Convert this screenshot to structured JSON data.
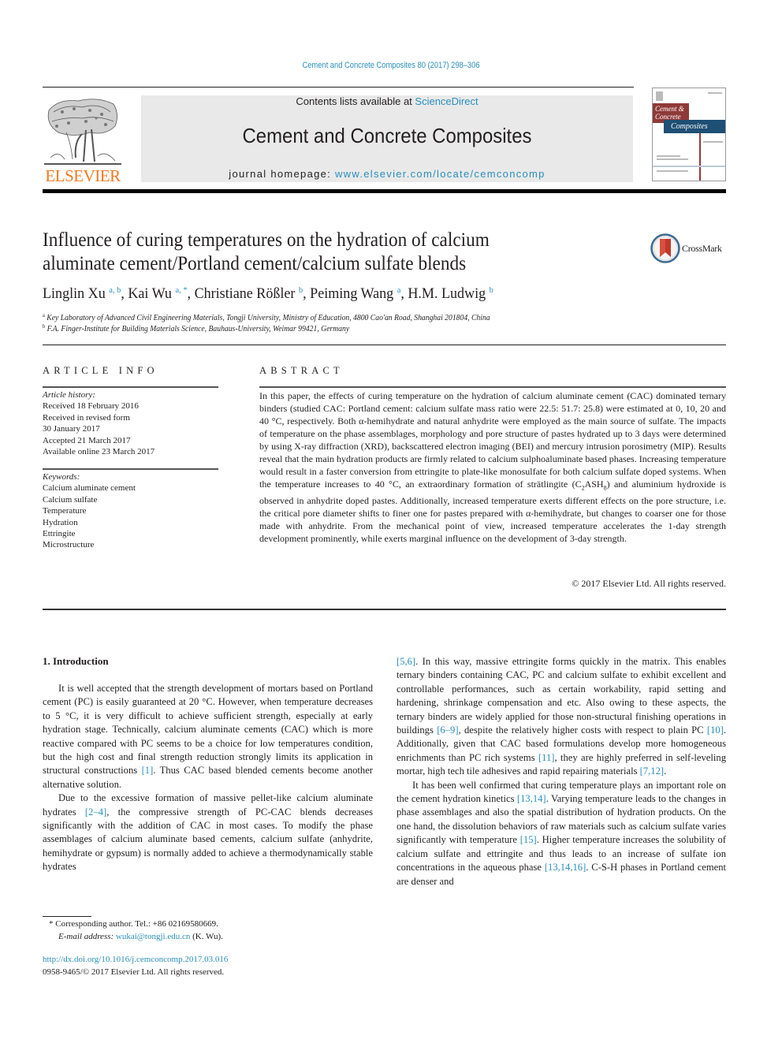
{
  "header": {
    "citation": "Cement and Concrete Composites 80 (2017) 298–306",
    "contents_prefix": "Contents lists available at ",
    "contents_link": "ScienceDirect",
    "journal_title": "Cement and Concrete Composites",
    "homepage_prefix": "journal homepage: ",
    "homepage_link": "www.elsevier.com/locate/cemconcomp",
    "publisher_logo_text": "ELSEVIER",
    "cover": {
      "title_line1": "Cement &",
      "title_line2": "Concrete",
      "title_line3": "Composites"
    },
    "crossmark_label": "CrossMark"
  },
  "colors": {
    "link": "#2a8fbd",
    "elsevier_orange": "#f47920",
    "masthead_bg": "#e9e9e9",
    "cover_red": "#8e3a38",
    "cover_blue": "#1e4f74"
  },
  "article": {
    "title_line1": "Influence of curing temperatures on the hydration of calcium",
    "title_line2": "aluminate cement/Portland cement/calcium sulfate blends",
    "authors": [
      {
        "name": "Linglin Xu",
        "sup": "a, b",
        "sep": ", "
      },
      {
        "name": "Kai Wu",
        "sup": "a, *",
        "sep": ", "
      },
      {
        "name": "Christiane Rößler",
        "sup": "b",
        "sep": ", "
      },
      {
        "name": "Peiming Wang",
        "sup": "a",
        "sep": ", "
      },
      {
        "name": "H.M. Ludwig",
        "sup": "b",
        "sep": ""
      }
    ],
    "affiliations": [
      {
        "key": "a",
        "text": "Key Laboratory of Advanced Civil Engineering Materials, Tongji University, Ministry of Education, 4800 Cao'an Road, Shanghai 201804, China"
      },
      {
        "key": "b",
        "text": "F.A. Finger-Institute for Building Materials Science, Bauhaus-University, Weimar 99421, Germany"
      }
    ]
  },
  "article_info": {
    "heading": "ARTICLE INFO",
    "history_label": "Article history:",
    "history": [
      "Received 18 February 2016",
      "Received in revised form",
      "30 January 2017",
      "Accepted 21 March 2017",
      "Available online 23 March 2017"
    ],
    "keywords_label": "Keywords:",
    "keywords": [
      "Calcium aluminate cement",
      "Calcium sulfate",
      "Temperature",
      "Hydration",
      "Ettringite",
      "Microstructure"
    ]
  },
  "abstract": {
    "heading": "ABSTRACT",
    "text_part1": "In this paper, the effects of curing temperature on the hydration of calcium aluminate cement (CAC) dominated ternary binders (studied CAC: Portland cement: calcium sulfate mass ratio were 22.5: 51.7: 25.8) were estimated at 0, 10, 20 and 40 °C, respectively. Both α-hemihydrate and natural anhydrite were employed as the main source of sulfate. The impacts of temperature on the phase assemblages, morphology and pore structure of pastes hydrated up to 3 days were determined by using X-ray diffraction (XRD), backscattered electron imaging (BEI) and mercury intrusion porosimetry (MIP). Results reveal that the main hydration products are firmly related to calcium sulphoaluminate based phases. Increasing temperature would result in a faster conversion from ettringite to plate-like monosulfate for both calcium sulfate doped systems. When the temperature increases to 40 °C, an extraordinary formation of strätlingite (C",
    "sub1": "2",
    "text_part2": "ASH",
    "sub2": "8",
    "text_part3": ") and aluminium hydroxide is observed in anhydrite doped pastes. Additionally, increased temperature exerts different effects on the pore structure, i.e. the critical pore diameter shifts to finer one for pastes prepared with α-hemihydrate, but changes to coarser one for those made with anhydrite. From the mechanical point of view, increased temperature accelerates the 1-day strength development prominently, while exerts marginal influence on the development of 3-day strength.",
    "copyright": "© 2017 Elsevier Ltd. All rights reserved."
  },
  "body": {
    "section_heading": "1.  Introduction",
    "left_paragraphs": [
      {
        "segments": [
          {
            "t": "It is well accepted that the strength development of mortars based on Portland cement (PC) is easily guaranteed at 20 °C. However, when temperature decreases to 5 °C, it is very difficult to achieve sufficient strength, especially at early hydration stage. Technically, calcium aluminate cements (CAC) which is more reactive compared with PC seems to be a choice for low temperatures condition, but the high cost and final strength reduction strongly limits its application in structural constructions "
          },
          {
            "ref": "[1]"
          },
          {
            "t": ". Thus CAC based blended cements become another alternative solution."
          }
        ]
      },
      {
        "segments": [
          {
            "t": "Due to the excessive formation of massive pellet-like calcium aluminate hydrates "
          },
          {
            "ref": "[2–4]"
          },
          {
            "t": ", the compressive strength of PC-CAC blends decreases significantly with the addition of CAC in most cases. To modify the phase assemblages of calcium aluminate based cements, calcium sulfate (anhydrite, hemihydrate or gypsum) is normally added to achieve a thermodynamically stable hydrates"
          }
        ]
      }
    ],
    "right_paragraphs": [
      {
        "noindent": true,
        "segments": [
          {
            "ref": "[5,6]"
          },
          {
            "t": ". In this way, massive ettringite forms quickly in the matrix. This enables ternary binders containing CAC, PC and calcium sulfate to exhibit excellent and controllable performances, such as certain workability, rapid setting and hardening, shrinkage compensation and etc. Also owing to these aspects, the ternary binders are widely applied for those non-structural finishing operations in buildings "
          },
          {
            "ref": "[6–9]"
          },
          {
            "t": ", despite the relatively higher costs with respect to plain PC "
          },
          {
            "ref": "[10]"
          },
          {
            "t": ". Additionally, given that CAC based formulations develop more homogeneous enrichments than PC rich systems "
          },
          {
            "ref": "[11]"
          },
          {
            "t": ", they are highly preferred in self-leveling mortar, high tech tile adhesives and rapid repairing materials "
          },
          {
            "ref": "[7,12]"
          },
          {
            "t": "."
          }
        ]
      },
      {
        "segments": [
          {
            "t": "It has been well confirmed that curing temperature plays an important role on the cement hydration kinetics "
          },
          {
            "ref": "[13,14]"
          },
          {
            "t": ". Varying temperature leads to the changes in phase assemblages and also the spatial distribution of hydration products. On the one hand, the dissolution behaviors of raw materials such as calcium sulfate varies significantly with temperature "
          },
          {
            "ref": "[15]"
          },
          {
            "t": ". Higher temperature increases the solubility of calcium sulfate and ettringite and thus leads to an increase of sulfate ion concentrations in the aqueous phase "
          },
          {
            "ref": "[13,14,16]"
          },
          {
            "t": ". C-S-H phases in Portland cement are denser and"
          }
        ]
      }
    ]
  },
  "footnote": {
    "marker": "*",
    "corresponding": " Corresponding author. Tel.: +86 02169580669.",
    "email_label": "E-mail address: ",
    "email": "wukai@tongji.edu.cn",
    "email_suffix": " (K. Wu).",
    "doi": "http://dx.doi.org/10.1016/j.cemconcomp.2017.03.016",
    "issn_line": "0958-9465/© 2017 Elsevier Ltd. All rights reserved."
  }
}
